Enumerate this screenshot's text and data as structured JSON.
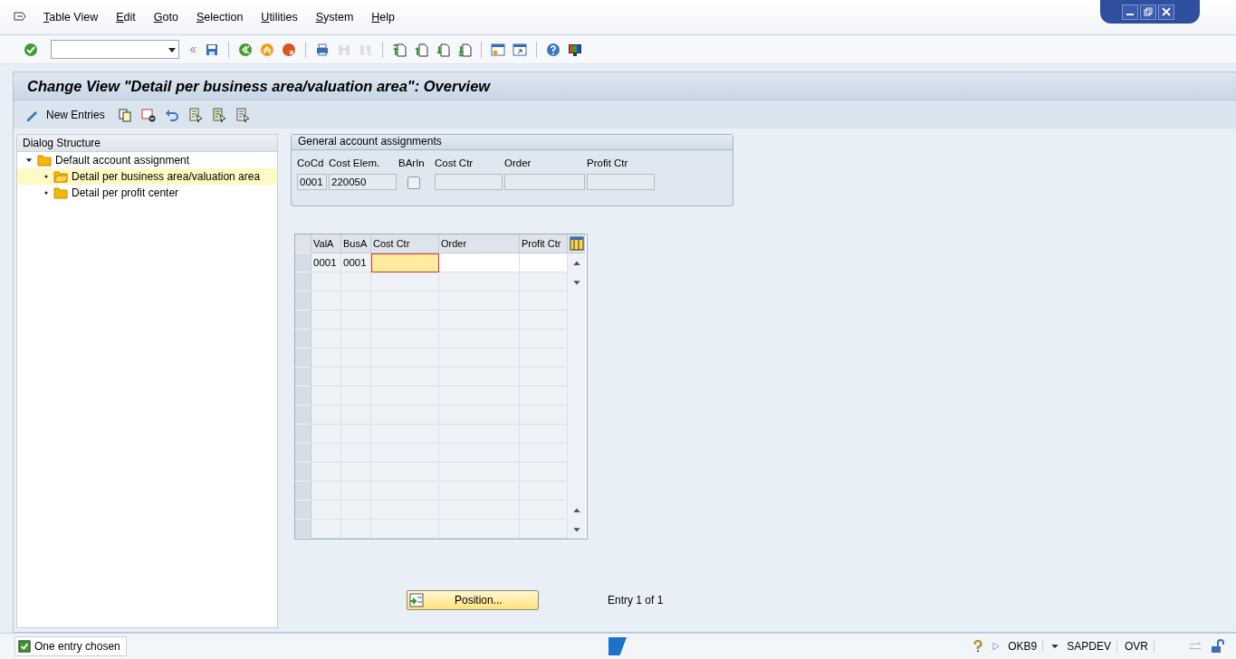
{
  "menu": [
    "Table View",
    "Edit",
    "Goto",
    "Selection",
    "Utilities",
    "System",
    "Help"
  ],
  "toolbar": {
    "groups": [
      [
        {
          "kind": "save",
          "disabled": false
        }
      ],
      [
        {
          "kind": "back",
          "disabled": false
        },
        {
          "kind": "exit",
          "disabled": false
        },
        {
          "kind": "cancel",
          "disabled": false
        }
      ],
      [
        {
          "kind": "print",
          "disabled": false
        },
        {
          "kind": "find",
          "disabled": true
        },
        {
          "kind": "find_next",
          "disabled": true
        }
      ],
      [
        {
          "kind": "first_page",
          "disabled": false
        },
        {
          "kind": "prev_page",
          "disabled": false
        },
        {
          "kind": "next_page",
          "disabled": false
        },
        {
          "kind": "last_page",
          "disabled": false
        }
      ],
      [
        {
          "kind": "new_session",
          "disabled": false
        },
        {
          "kind": "shortcut",
          "disabled": false
        }
      ],
      [
        {
          "kind": "help",
          "disabled": false
        },
        {
          "kind": "layout",
          "disabled": false
        }
      ]
    ]
  },
  "title": "Change View \"Detail per business area/valuation area\": Overview",
  "app_toolbar": {
    "new_entries": "New Entries"
  },
  "dialog_structure": {
    "title": "Dialog Structure",
    "items": [
      {
        "label": "Default account assignment",
        "expanded": true,
        "selected": false,
        "children": [
          {
            "label": "Detail per business area/valuation area",
            "selected": true
          },
          {
            "label": "Detail per profit center",
            "selected": false
          }
        ]
      }
    ]
  },
  "general": {
    "title": "General account assignments",
    "fields": [
      {
        "kind": "text",
        "label": "CoCd",
        "value": "0001"
      },
      {
        "kind": "text",
        "label": "Cost Elem.",
        "value": "220050"
      },
      {
        "kind": "checkbox",
        "label": "BArIn",
        "checked": false
      },
      {
        "kind": "text",
        "label": "Cost Ctr"
      },
      {
        "kind": "text",
        "label": "Order"
      },
      {
        "kind": "text",
        "label": "Profit Ctr"
      }
    ]
  },
  "table": {
    "columns": [
      "ValA",
      "BusA",
      "Cost Ctr",
      "Order",
      "Profit Ctr"
    ],
    "rows": [
      {
        "cells": [
          {
            "text": "0001",
            "focused": false
          },
          {
            "text": "0001",
            "focused": false
          },
          {
            "focused": true
          },
          {
            "focused": false
          },
          {
            "focused": false
          }
        ]
      }
    ]
  },
  "position_button": "Position...",
  "entry_info": "Entry 1 of 1",
  "status_bar": {
    "message": "One entry chosen",
    "kind": "success",
    "transaction": "OKB9",
    "system": "SAPDEV",
    "mode": "OVR"
  }
}
